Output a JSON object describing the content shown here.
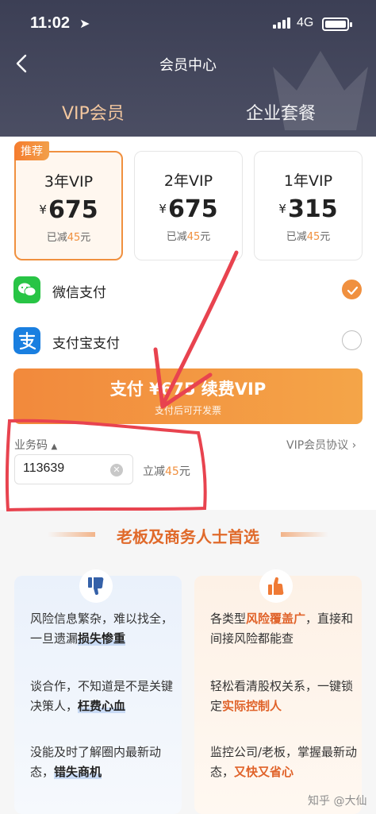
{
  "status": {
    "time": "11:02",
    "network": "4G"
  },
  "nav": {
    "title": "会员中心"
  },
  "tabs": [
    {
      "label": "VIP会员"
    },
    {
      "label": "企业套餐"
    }
  ],
  "plans": [
    {
      "badge": "推荐",
      "name": "3年VIP",
      "currency": "¥",
      "price": "675",
      "discount_prefix": "已减",
      "discount": "45",
      "discount_suffix": "元"
    },
    {
      "name": "2年VIP",
      "currency": "¥",
      "price": "675",
      "discount_prefix": "已减",
      "discount": "45",
      "discount_suffix": "元"
    },
    {
      "name": "1年VIP",
      "currency": "¥",
      "price": "315",
      "discount_prefix": "已减",
      "discount": "45",
      "discount_suffix": "元"
    }
  ],
  "payment": [
    {
      "label": "微信支付",
      "selected": true,
      "icon": "wechat-icon"
    },
    {
      "label": "支付宝支付",
      "selected": false,
      "icon": "alipay-icon"
    }
  ],
  "pay_button": {
    "main": "支付 ¥675 续费VIP",
    "sub": "支付后可开发票"
  },
  "business_code": {
    "label": "业务码",
    "value": "113639",
    "reduce_prefix": "立减",
    "reduce": "45",
    "reduce_suffix": "元"
  },
  "agreement": "VIP会员协议",
  "section": {
    "title": "老板及商务人士首选"
  },
  "cons": [
    {
      "text": "风险信息繁杂，难以找全，一旦遗漏",
      "bold": "损失惨重"
    },
    {
      "text": "谈合作，不知道是不是关键决策人，",
      "bold": "枉费心血"
    },
    {
      "text": "没能及时了解圈内最新动态，",
      "bold": "错失商机"
    }
  ],
  "pros": [
    {
      "pre": "各类型",
      "bold": "风险覆盖广",
      "post": "，直接和间接风险都能查"
    },
    {
      "pre": "轻松看清股权关系，一键锁定",
      "bold": "实际控制人",
      "post": ""
    },
    {
      "pre": "监控公司/老板，掌握最新动态，",
      "bold": "又快又省心",
      "post": ""
    }
  ],
  "watermark": "知乎 @大仙",
  "colors": {
    "accent": "#f0903f",
    "header": "#454860",
    "annotation": "#e8434f"
  }
}
